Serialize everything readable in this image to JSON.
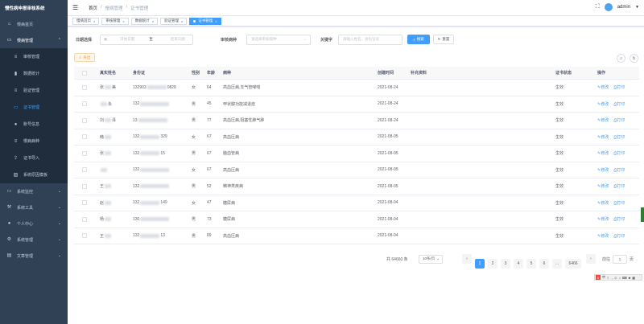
{
  "app": {
    "title": "慢性病申报审核系统"
  },
  "sidebar": {
    "items": [
      {
        "label": "慢病首页",
        "icon": "home-icon"
      },
      {
        "label": "慢病管理",
        "icon": "monitor-icon",
        "open": true
      },
      {
        "label": "系统监控",
        "icon": "monitor-icon"
      },
      {
        "label": "系统工具",
        "icon": "tool-icon"
      },
      {
        "label": "个人中心",
        "icon": "user-icon"
      },
      {
        "label": "系统管理",
        "icon": "gear-icon"
      },
      {
        "label": "文章管理",
        "icon": "document-icon"
      }
    ],
    "sub_items": [
      {
        "label": "审核管理",
        "icon": "list-icon"
      },
      {
        "label": "数据统计",
        "icon": "chart-icon"
      },
      {
        "label": "验证管理",
        "icon": "list-icon"
      },
      {
        "label": "证书管理",
        "icon": "certificate-icon",
        "active": true
      },
      {
        "label": "账号信息",
        "icon": "user-icon"
      },
      {
        "label": "慢病病种",
        "icon": "list-icon"
      },
      {
        "label": "证书导入",
        "icon": "upload-icon"
      },
      {
        "label": "系统原因模板",
        "icon": "template-icon"
      }
    ]
  },
  "header": {
    "breadcrumb": [
      "首页",
      "慢病管理",
      "证书管理"
    ],
    "user": "admin"
  },
  "tags": [
    {
      "label": "慢病首页",
      "active": false
    },
    {
      "label": "审核管理",
      "active": false
    },
    {
      "label": "数据统计",
      "active": false
    },
    {
      "label": "验证管理",
      "active": false
    },
    {
      "label": "证书管理",
      "active": true
    }
  ],
  "search": {
    "date_label": "日期选择",
    "date_start_placeholder": "开始日期",
    "date_sep": "至",
    "date_end_placeholder": "结束日期",
    "disease_label": "审核病种",
    "disease_placeholder": "请选择审核病种",
    "keyword_label": "关键字",
    "keyword_placeholder": "请输入姓名、身份证号",
    "search_btn": "搜索",
    "reset_btn": "重置"
  },
  "toolbar": {
    "export_btn": "导出"
  },
  "table": {
    "headers": {
      "name": "真实姓名",
      "id": "身份证",
      "sex": "性别",
      "age": "年龄",
      "disease": "病种",
      "created": "创建时间",
      "extra": "补充资料",
      "status": "证书状态",
      "ops": "操作"
    },
    "op_edit": "修改",
    "op_print": "打印",
    "rows": [
      {
        "name_a": "张",
        "name_b": "美",
        "id_a": "132903",
        "id_b": "0828",
        "sex": "女",
        "age": "64",
        "disease": "高血压病,支气管哮喘",
        "created": "2021-08-24",
        "status": "生效"
      },
      {
        "name_a": "",
        "name_b": "永",
        "id_a": "132",
        "id_b": "",
        "sex": "男",
        "age": "45",
        "disease": "甲状腺功能减退症",
        "created": "2021-08-24",
        "status": "生效"
      },
      {
        "name_a": "刘",
        "name_b": "泽",
        "id_a": "13",
        "id_b": "",
        "sex": "男",
        "age": "77",
        "disease": "高血压病,阻塞性肺气肿",
        "created": "2021-08-24",
        "status": "生效"
      },
      {
        "name_a": "韩",
        "name_b": "",
        "id_a": "132",
        "id_b": "329",
        "sex": "女",
        "age": "67",
        "disease": "高血压病",
        "created": "2021-08-05",
        "status": "生效"
      },
      {
        "name_a": "张",
        "name_b": "",
        "id_a": "132",
        "id_b": "15",
        "sex": "男",
        "age": "67",
        "disease": "脑血管病",
        "created": "2021-08-05",
        "status": "生效"
      },
      {
        "name_a": "",
        "name_b": "",
        "id_a": "132",
        "id_b": "",
        "sex": "女",
        "age": "67",
        "disease": "高血压病",
        "created": "2021-08-05",
        "status": "生效"
      },
      {
        "name_a": "王",
        "name_b": "",
        "id_a": "132",
        "id_b": "",
        "sex": "男",
        "age": "52",
        "disease": "精神类疾病",
        "created": "2021-08-05",
        "status": "生效"
      },
      {
        "name_a": "赵",
        "name_b": "",
        "id_a": "132",
        "id_b": "149",
        "sex": "女",
        "age": "47",
        "disease": "糖尿病",
        "created": "2021-08-04",
        "status": "生效"
      },
      {
        "name_a": "杨",
        "name_b": "",
        "id_a": "130",
        "id_b": "",
        "sex": "男",
        "age": "73",
        "disease": "糖尿病",
        "created": "2021-08-04",
        "status": "生效"
      },
      {
        "name_a": "王",
        "name_b": "",
        "id_a": "132",
        "id_b": "13",
        "sex": "男",
        "age": "89",
        "disease": "高血压病",
        "created": "2021-08-04",
        "status": "生效"
      }
    ]
  },
  "pagination": {
    "total": "共 64660 条",
    "page_size": "10条/页",
    "pages": [
      "1",
      "2",
      "3",
      "4",
      "5",
      "6",
      "...",
      "6466"
    ],
    "current": "1",
    "goto_label": "前往",
    "goto_value": "1",
    "page_unit": "页"
  }
}
